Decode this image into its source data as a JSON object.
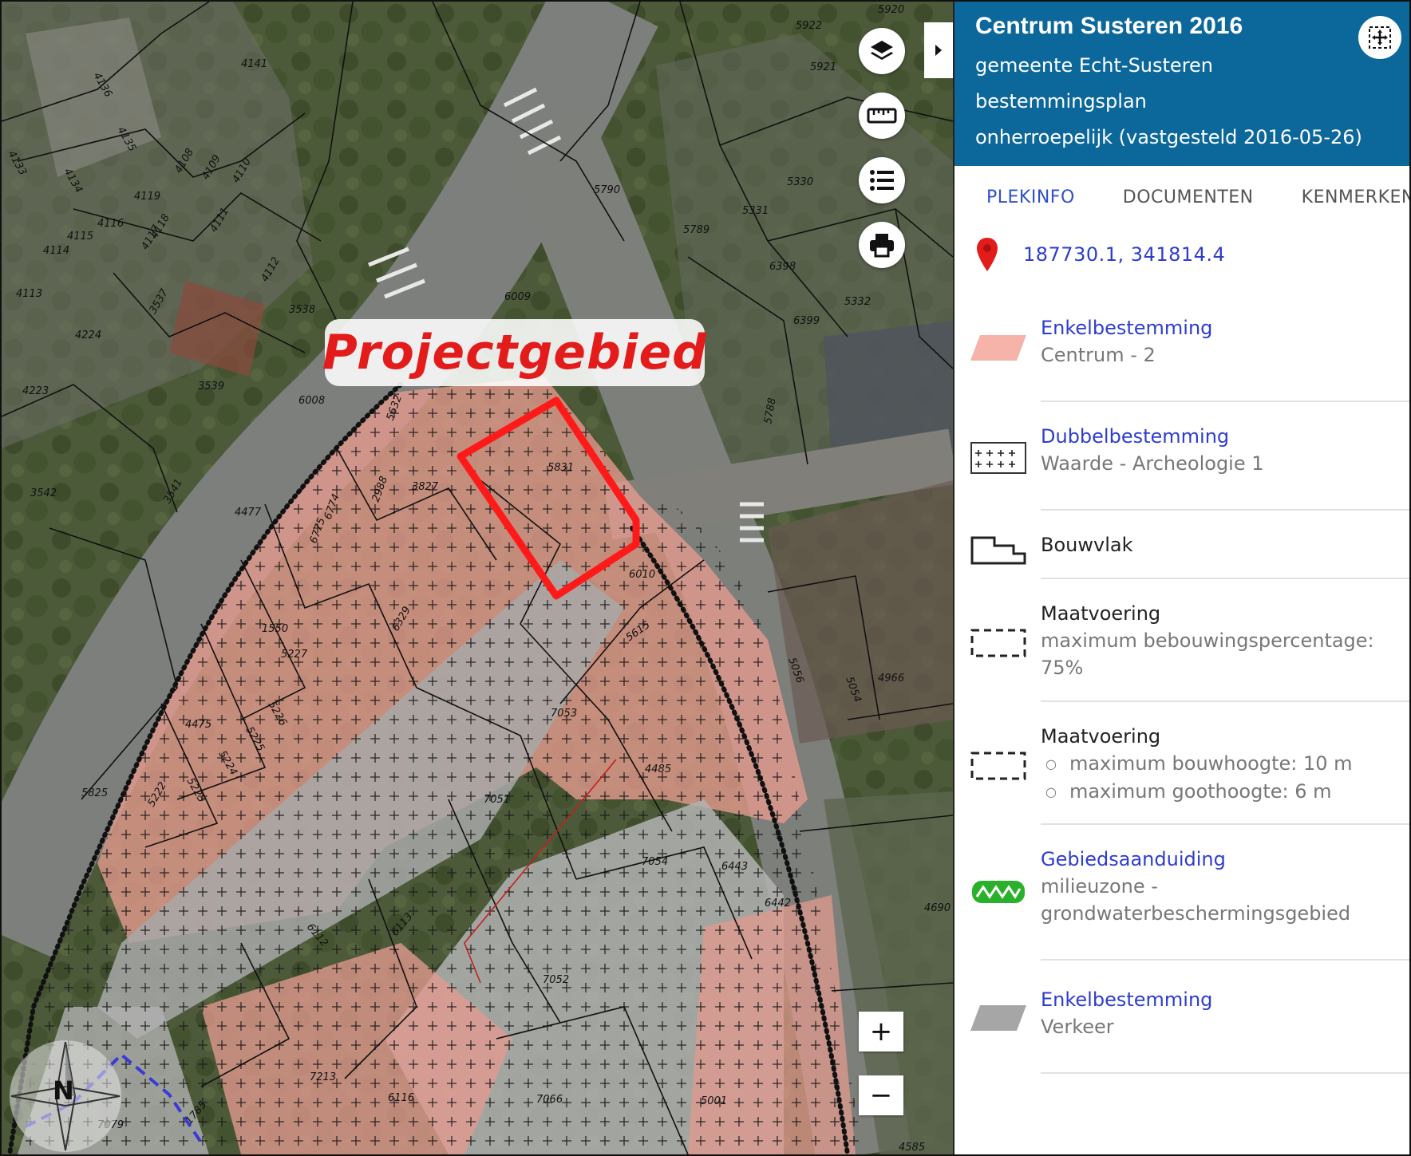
{
  "map": {
    "project_label": "Projectgebied",
    "north_label": "N",
    "zoom_in": "+",
    "zoom_out": "−",
    "tools": [
      "layers-icon",
      "ruler-icon",
      "legend-list-icon",
      "print-icon"
    ],
    "colors": {
      "highlight": "#ff1a1a",
      "centrum_fill": "#e8a095",
      "verkeer_fill": "#b8b8b8",
      "archeology_cross": "#222222"
    },
    "parcel_labels": [
      "5920",
      "5922",
      "5921",
      "4136",
      "4141",
      "4135",
      "4133",
      "4134",
      "4108",
      "4109",
      "4110",
      "4119",
      "4116",
      "4115",
      "4118",
      "4117",
      "4114",
      "4111",
      "4112",
      "4113",
      "3537",
      "3538",
      "4224",
      "4223",
      "3539",
      "3542",
      "3541",
      "6008",
      "4477",
      "5790",
      "5789",
      "5330",
      "5331",
      "6398",
      "6399",
      "5332",
      "5788",
      "6009",
      "5831",
      "3827",
      "2988",
      "6774",
      "6775",
      "5632",
      "6010",
      "5615",
      "1550",
      "6329",
      "5227",
      "5226",
      "5225",
      "5224",
      "5223",
      "5222",
      "4475",
      "5825",
      "7053",
      "4485",
      "7051",
      "7054",
      "6443",
      "6442",
      "6113",
      "6112",
      "7052",
      "7213",
      "6116",
      "7066",
      "5001",
      "1785",
      "5056",
      "5054",
      "4966",
      "4690",
      "4585",
      "7079"
    ]
  },
  "panel": {
    "title": "Centrum Susteren 2016",
    "municipality": "gemeente Echt-Susteren",
    "plan_type": "bestemmingsplan",
    "status": "onherroepelijk (vastgesteld 2016-05-26)",
    "tabs": [
      "PLEKINFO",
      "DOCUMENTEN",
      "KENMERKEN"
    ],
    "coordinates": "187730.1, 341814.4",
    "legend": [
      {
        "title": "Enkelbestemming",
        "desc": "Centrum - 2"
      },
      {
        "title": "Dubbelbestemming",
        "desc": "Waarde - Archeologie 1"
      },
      {
        "title": "Bouwvlak"
      },
      {
        "title": "Maatvoering",
        "desc1": "maximum bebouwingspercentage:",
        "desc2": "75%"
      },
      {
        "title": "Maatvoering",
        "items": [
          "maximum bouwhoogte: 10 m",
          "maximum goothoogte: 6 m"
        ]
      },
      {
        "title": "Gebiedsaanduiding",
        "desc1": "milieuzone -",
        "desc2": "grondwaterbeschermingsgebied"
      },
      {
        "title": "Enkelbestemming",
        "desc": "Verkeer"
      }
    ]
  }
}
